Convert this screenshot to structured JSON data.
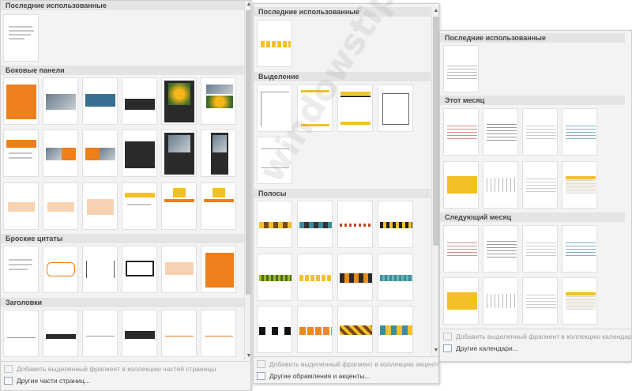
{
  "watermark": "windowstips.ru",
  "building_blocks": {
    "sections": {
      "recent": "Последние использованные",
      "sidebars": "Боковые панели",
      "quotes": "Броские цитаты",
      "headings": "Заголовки"
    },
    "footer": {
      "add": "Добавить выделенный фрагмент в коллекцию частей страницы",
      "more": "Другие части страниц..."
    }
  },
  "borders": {
    "sections": {
      "recent": "Последние использованные",
      "selection": "Выделение",
      "stripes": "Полосы"
    },
    "footer": {
      "add": "Добавить выделенный фрагмент в коллекцию акцентов",
      "more": "Другие обрамления и акценты..."
    }
  },
  "calendars": {
    "sections": {
      "recent": "Последние использованные",
      "this_month": "Этот месяц",
      "next_month": "Следующий месяц"
    },
    "footer": {
      "add": "Добавить выделенный фрагмент в коллекцию календарей",
      "more": "Другие календари..."
    }
  },
  "colors": {
    "accent_orange": "#ef7f1a",
    "accent_yellow": "#f3c028",
    "dark": "#2a2a2a",
    "teal": "#3a8e9a"
  }
}
